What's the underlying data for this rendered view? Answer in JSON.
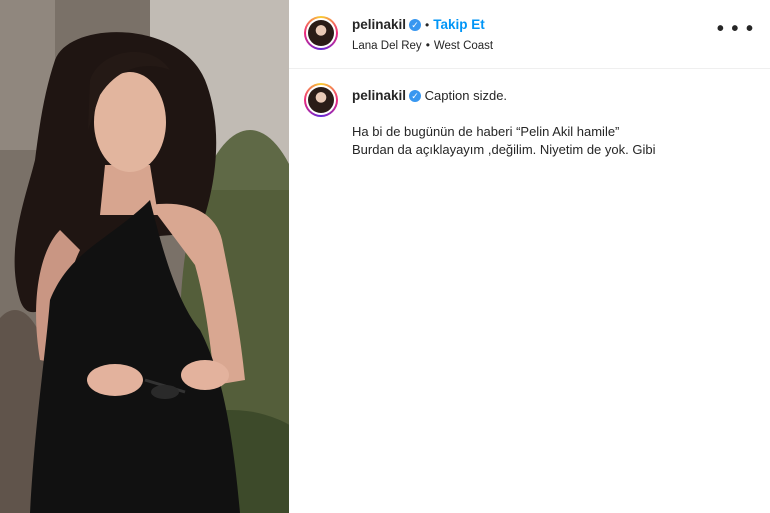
{
  "post": {
    "username": "pelinakil",
    "follow_label": "Takip Et",
    "separator": "•",
    "audio": {
      "artist": "Lana Del Rey",
      "track": "West Coast"
    },
    "caption": {
      "first_line": "Caption sizde.",
      "line2": "Ha bi de bugünün de haberi “Pelin Akil hamile”",
      "line3": "Burdan da açıklayayım ,değilim. Niyetim de yok. Gibi"
    },
    "more_icon": "more-options-icon",
    "verified_icon": "verified-badge-icon"
  },
  "colors": {
    "link_blue": "#0095f6",
    "verified_blue": "#3897f0",
    "text": "#262626"
  }
}
